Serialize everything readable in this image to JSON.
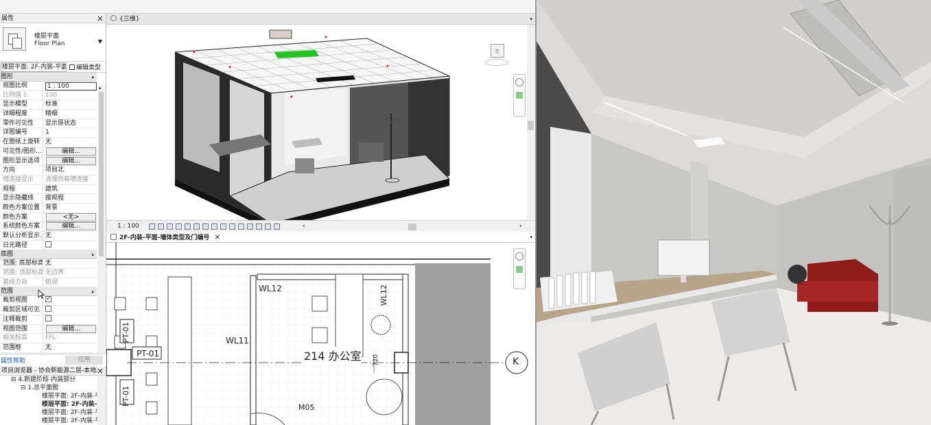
{
  "properties": {
    "title": "属性",
    "type_name_cn": "楼层平面",
    "type_name_en": "Floor Plan",
    "selector": "楼层平面: 2F-内装-平面",
    "edit_type": "编辑类型",
    "sections": {
      "graphics": "图形",
      "underlay": "底图",
      "extents": "范围"
    },
    "rows": [
      {
        "k": "视图比例",
        "v": "1 : 100"
      },
      {
        "k": "比例值 1:",
        "v": "100"
      },
      {
        "k": "显示模型",
        "v": "标准"
      },
      {
        "k": "详细程度",
        "v": "精细"
      },
      {
        "k": "零件可见性",
        "v": "显示原状态"
      },
      {
        "k": "详图编号",
        "v": "1"
      },
      {
        "k": "在图纸上旋转",
        "v": "无"
      },
      {
        "k": "可见性/图形...",
        "v": "编辑..."
      },
      {
        "k": "图形显示选项",
        "v": "编辑..."
      },
      {
        "k": "方向",
        "v": "项目北"
      },
      {
        "k": "墙连接显示",
        "v": "清理所有墙连接"
      },
      {
        "k": "规程",
        "v": "建筑"
      },
      {
        "k": "显示隐藏线",
        "v": "按规程"
      },
      {
        "k": "颜色方案位置",
        "v": "背景"
      },
      {
        "k": "颜色方案",
        "v": "<无>"
      },
      {
        "k": "系统颜色方案",
        "v": "编辑..."
      },
      {
        "k": "默认分析显示...",
        "v": "无"
      },
      {
        "k": "日光路径",
        "v": ""
      }
    ],
    "underlay_rows": [
      {
        "k": "范围: 底部标高",
        "v": "无"
      },
      {
        "k": "范围: 顶部标高",
        "v": "无边界"
      },
      {
        "k": "基线方向",
        "v": "俯视"
      }
    ],
    "extent_rows": [
      {
        "k": "裁剪视图",
        "v": ""
      },
      {
        "k": "裁剪区域可见",
        "v": ""
      },
      {
        "k": "注释裁剪",
        "v": ""
      },
      {
        "k": "视图范围",
        "v": "编辑..."
      },
      {
        "k": "相关标高",
        "v": "FFL"
      },
      {
        "k": "范围框",
        "v": "无"
      }
    ],
    "help_link": "属性帮助",
    "apply": "应用"
  },
  "browser": {
    "title": "项目浏览器 - 协合新能源二层-本地...",
    "items": [
      "4.新建阶段-内装部分",
      "1.总平面图",
      "楼层平面: 2F-内装-平",
      "楼层平面: 2F-内装-平",
      "楼层平面: 2F-内装-平",
      "楼层平面: 2F-内装-平"
    ]
  },
  "view3d": {
    "tab": "{三维}",
    "scale": "1 : 100",
    "cube_label": "左"
  },
  "plan": {
    "tab": "2F-内装-平面-墙体类型及门编号",
    "labels": {
      "wl12a": "WL12",
      "wl12b": "WL12",
      "wl11": "WL11",
      "pt01a": "PT-01",
      "pt01b": "PT-01",
      "pt01c": "PT-01",
      "room": "214 办公室",
      "dim": "720",
      "m05": "M05",
      "grid": "K"
    }
  }
}
